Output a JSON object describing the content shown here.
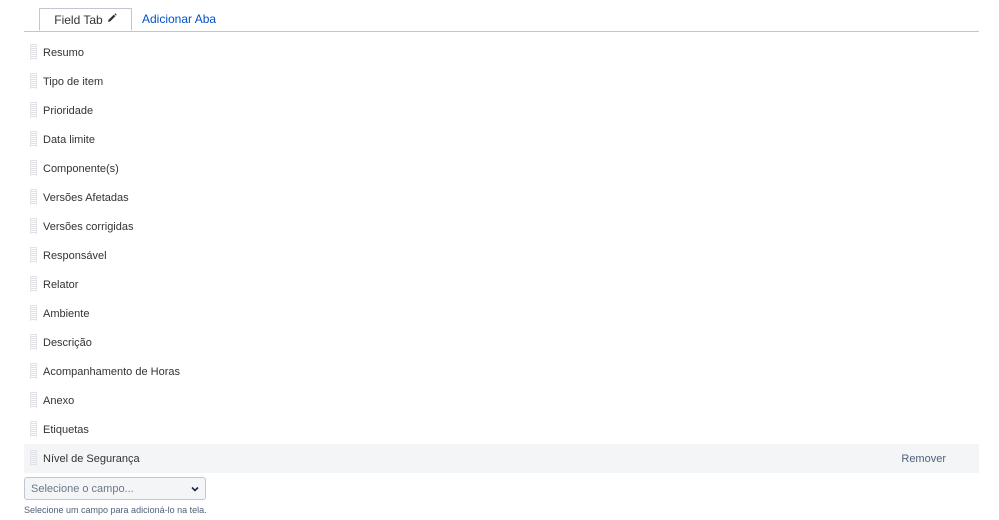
{
  "tabs": {
    "active_label": "Field Tab",
    "add_label": "Adicionar Aba"
  },
  "fields": [
    {
      "label": "Resumo"
    },
    {
      "label": "Tipo de item"
    },
    {
      "label": "Prioridade"
    },
    {
      "label": "Data limite"
    },
    {
      "label": "Componente(s)"
    },
    {
      "label": "Versões Afetadas"
    },
    {
      "label": "Versões corrigidas"
    },
    {
      "label": "Responsável"
    },
    {
      "label": "Relator"
    },
    {
      "label": "Ambiente"
    },
    {
      "label": "Descrição"
    },
    {
      "label": "Acompanhamento de Horas"
    },
    {
      "label": "Anexo"
    },
    {
      "label": "Etiquetas"
    },
    {
      "label": "Nível de Segurança",
      "remove_label": "Remover"
    }
  ],
  "add_field": {
    "placeholder": "Selecione o campo...",
    "help": "Selecione um campo para adicioná-lo na tela."
  },
  "icons": {
    "tab_edit": "pencil-icon",
    "drag": "drag-handle-icon",
    "select": "chevron-down-icon"
  },
  "colors": {
    "link": "#0052cc",
    "hover_row": "#f4f5f7",
    "border": "#c1c7d0"
  }
}
